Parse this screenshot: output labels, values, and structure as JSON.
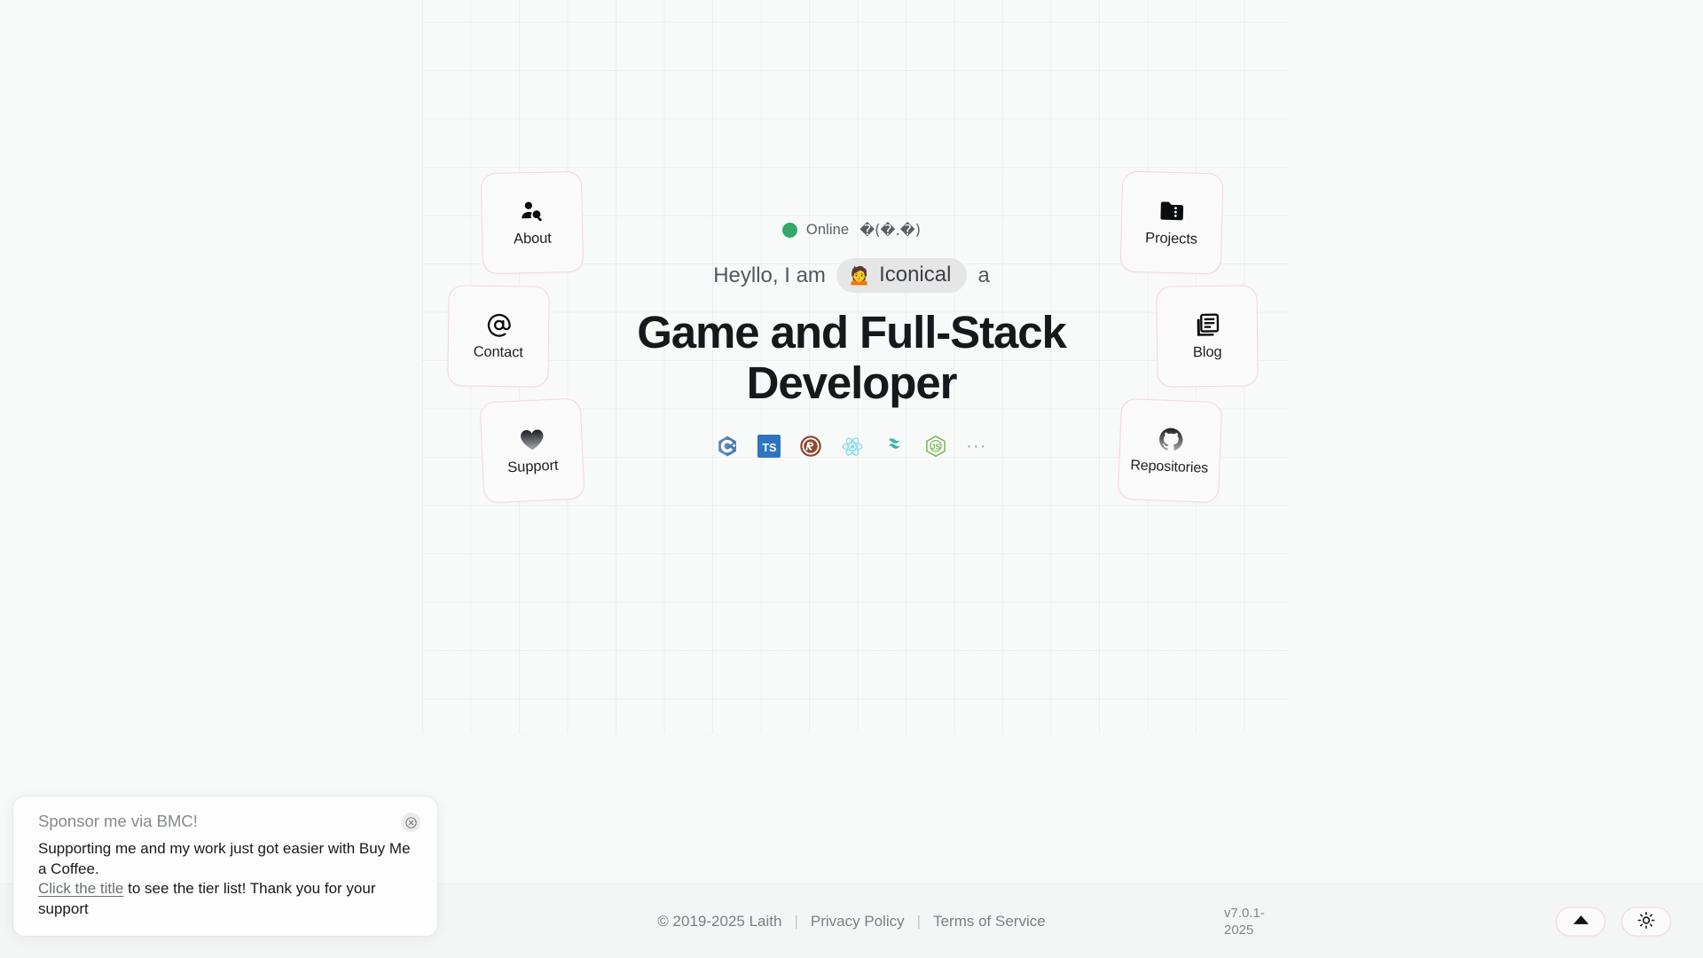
{
  "hero": {
    "status": {
      "state": "Online",
      "kaomoji": "�(�.�)",
      "dot_color": "#34a868"
    },
    "greeting_pre": "Heyllo, I am",
    "name": "Iconical",
    "avatar_emoji": "🙍",
    "greeting_post": "a",
    "headline": "Game and Full-Stack Developer",
    "tech_stack": [
      {
        "name": "cplusplus-icon",
        "label": "C++"
      },
      {
        "name": "typescript-icon",
        "label": "TypeScript"
      },
      {
        "name": "rust-icon",
        "label": "Rust"
      },
      {
        "name": "react-icon",
        "label": "React"
      },
      {
        "name": "tailwindcss-icon",
        "label": "Tailwind CSS"
      },
      {
        "name": "nodejs-icon",
        "label": "Node.js"
      }
    ],
    "tech_more": "···"
  },
  "nav_cards": {
    "left": [
      {
        "id": "about",
        "label": "About",
        "icon": "user-search-icon"
      },
      {
        "id": "contact",
        "label": "Contact",
        "icon": "at-sign-icon"
      },
      {
        "id": "support",
        "label": "Support",
        "icon": "heart-icon"
      }
    ],
    "right": [
      {
        "id": "projects",
        "label": "Projects",
        "icon": "folder-kanban-icon"
      },
      {
        "id": "blog",
        "label": "Blog",
        "icon": "newspaper-icon"
      },
      {
        "id": "repositories",
        "label": "Repositories",
        "icon": "github-icon"
      }
    ]
  },
  "footer": {
    "copyright": "© 2019-2025 Laith",
    "sep": "|",
    "privacy": "Privacy Policy",
    "terms": "Terms of Service",
    "version": "v7.0.1-2025",
    "scroll_top_label": "scroll-to-top",
    "theme_label": "toggle-theme"
  },
  "toast": {
    "title": "Sponsor me via BMC!",
    "body_line1": "Supporting me and my work just got easier with Buy Me a Coffee.",
    "link_text": "Click the title",
    "body_line2": " to see the tier list! Thank you for your support",
    "close_label": "×"
  },
  "theme": {
    "accent_border": "#f3d7dc",
    "card_bg": "#fafafa",
    "page_bg": "#f7f8f8"
  }
}
